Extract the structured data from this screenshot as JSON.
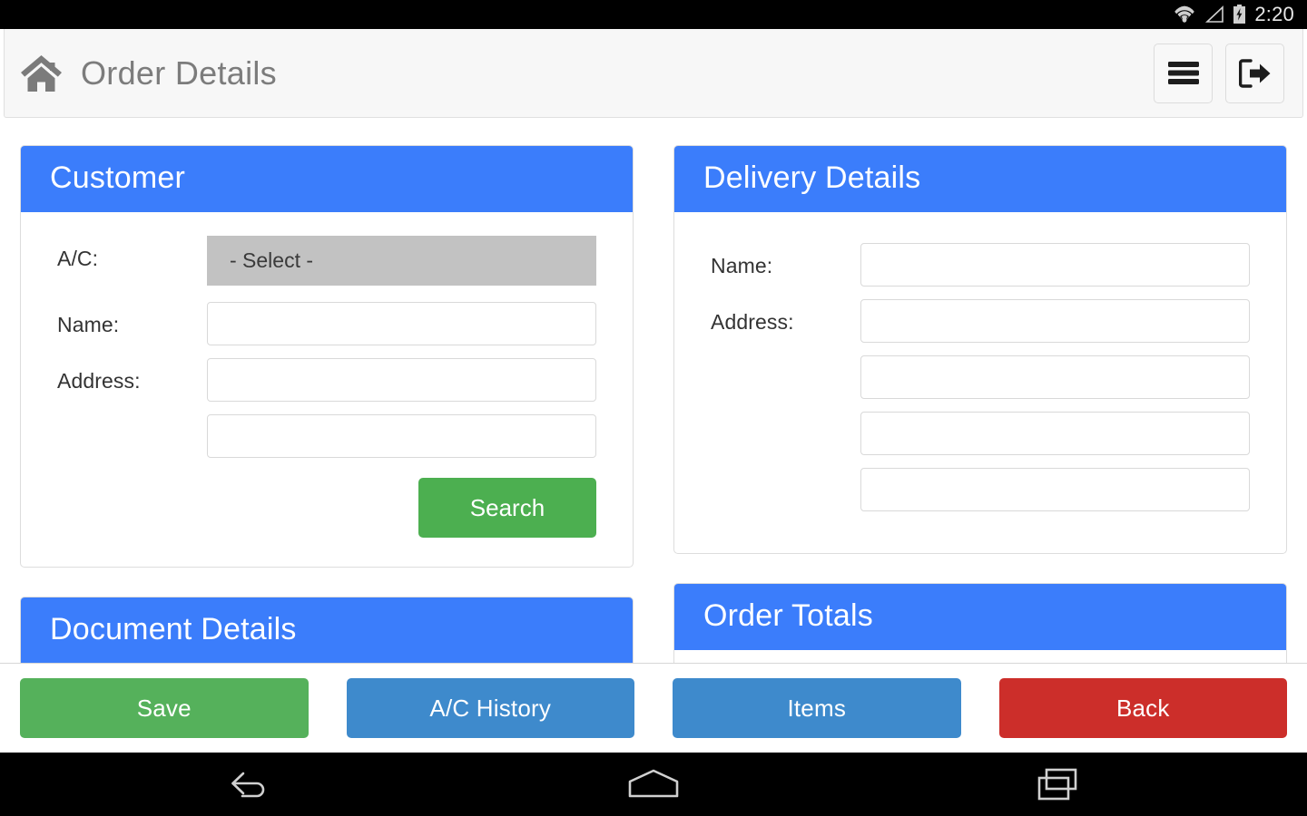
{
  "status_bar": {
    "time": "2:20",
    "icons": [
      "wifi-icon",
      "cell-signal-icon",
      "battery-charging-icon"
    ]
  },
  "toolbar": {
    "title": "Order Details",
    "home_icon": "home-icon",
    "menu_icon": "hamburger-menu-icon",
    "logout_icon": "sign-out-icon"
  },
  "colors": {
    "card_header_blue": "#3b7dfb",
    "button_green": "#55b15b",
    "button_blue": "#3e8acc",
    "button_red": "#cc2e2a",
    "search_green": "#4caf50",
    "select_grey": "#c2c2c2",
    "toolbar_grey": "#f7f7f7"
  },
  "cards": {
    "customer": {
      "title": "Customer",
      "ac_label": "A/C:",
      "ac_value": "- Select -",
      "name_label": "Name:",
      "name_value": "",
      "name_placeholder": "",
      "address_label": "Address:",
      "address_line1": "",
      "address_line2": "",
      "search_label": "Search"
    },
    "delivery": {
      "title": "Delivery Details",
      "name_label": "Name:",
      "name_value": "",
      "address_label": "Address:",
      "address_line1": "",
      "address_line2": "",
      "address_line3": "",
      "address_line4": ""
    },
    "document": {
      "title": "Document Details"
    },
    "order_totals": {
      "title": "Order Totals"
    }
  },
  "action_bar": {
    "save_label": "Save",
    "ac_history_label": "A/C History",
    "items_label": "Items",
    "back_label": "Back"
  },
  "nav_bar": {
    "back_icon": "android-back-icon",
    "home_icon": "android-home-icon",
    "recents_icon": "android-recents-icon"
  }
}
